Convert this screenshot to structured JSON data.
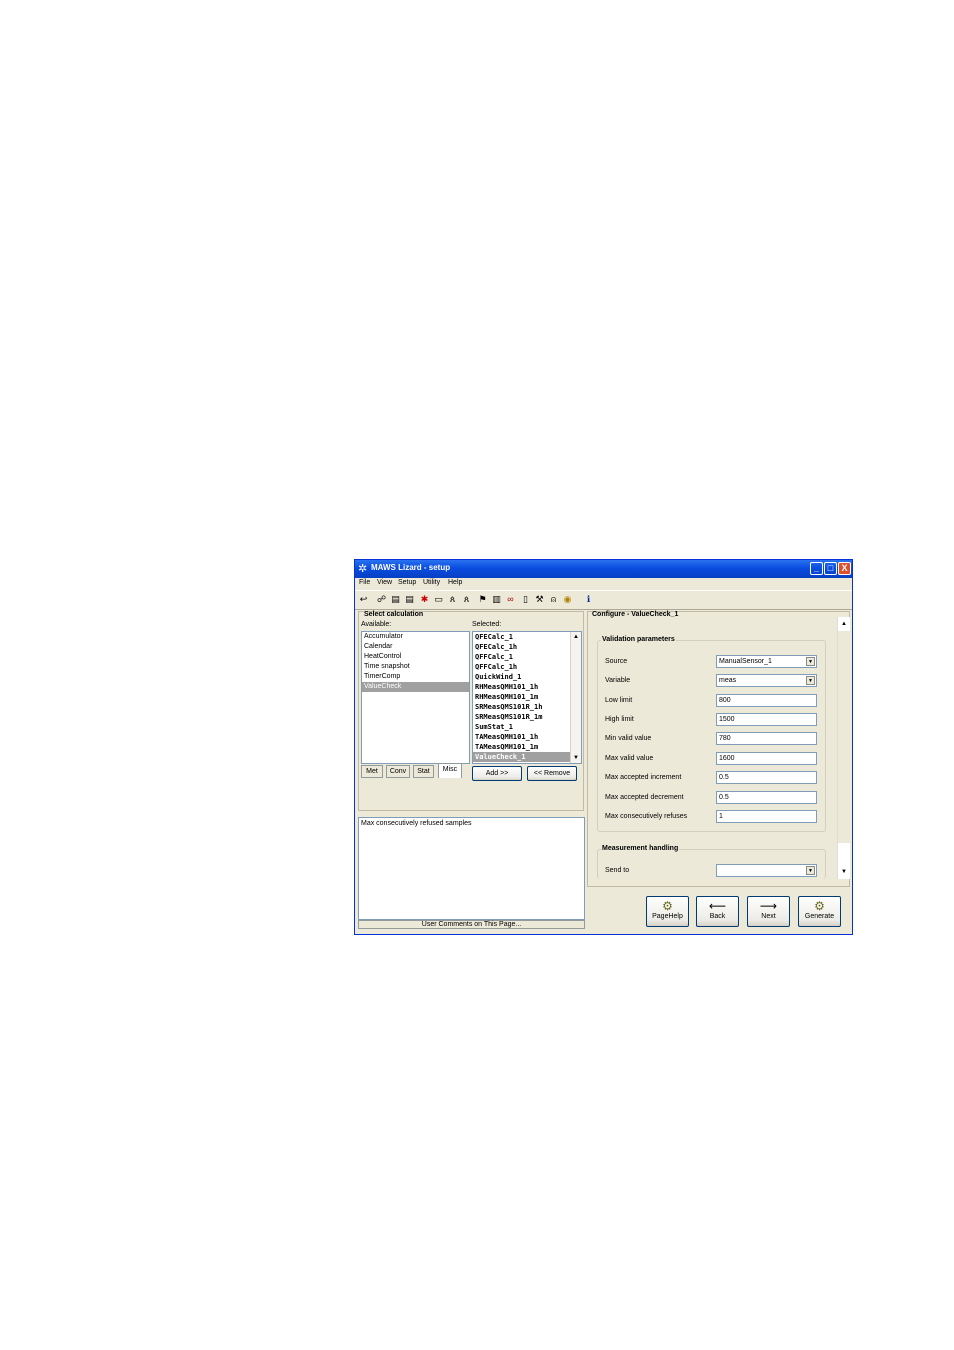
{
  "window": {
    "title": "MAWS Lizard - setup",
    "title_icon": "lizard-icon",
    "controls": [
      "_",
      "□",
      "X"
    ]
  },
  "menu": [
    "File",
    "View",
    "Setup",
    "Utility",
    "Help"
  ],
  "toolbar": {
    "icons": [
      "undo-icon",
      "network-icon",
      "dev-icon",
      "dev-icon",
      "sensor-icon",
      "display-icon",
      "person-icon",
      "person-icon",
      "flag-icon",
      "chart-icon",
      "link-icon",
      "page-icon",
      "wrench-icon",
      "bell-icon",
      "coin-icon",
      "info-icon"
    ],
    "glyphs": [
      "↩",
      "☍",
      "▤",
      "▤",
      "✱",
      "▭",
      "ጰ",
      "ጰ",
      "⚑",
      "▥",
      "∞",
      "▯",
      "⚒",
      "⍝",
      "◉",
      "ℹ"
    ]
  },
  "left": {
    "section_title": "Select calculation",
    "available_label": "Available:",
    "selected_label": "Selected:",
    "available": [
      "Accumulator",
      "Calendar",
      "HeatControl",
      "Time snapshot",
      "TimerComp",
      "ValueCheck"
    ],
    "available_selected_index": 5,
    "selected": [
      "QFECalc_1",
      "QFECalc_1h",
      "QFFCalc_1",
      "QFFCalc_1h",
      "QuickWind_1",
      "RHMeasQMH101_1h",
      "RHMeasQMH101_1m",
      "SRMeasQMS101R_1h",
      "SRMeasQMS101R_1m",
      "SumStat_1",
      "TAMeasQMH101_1h",
      "TAMeasQMH101_1m",
      "ValueCheck_1"
    ],
    "selected_selected_index": 12,
    "tabs": [
      "Met",
      "Conv",
      "Stat",
      "Misc"
    ],
    "active_tab": "Misc",
    "add_label": "Add >>",
    "remove_label": "<< Remove",
    "comment_text": "Max consecutively refused samples",
    "comments_bar": "User Comments on This Page..."
  },
  "right": {
    "header": "Configure - ValueCheck_1",
    "validation_group": "Validation parameters",
    "fields": [
      {
        "label": "Source",
        "value": "ManualSensor_1",
        "combo": true
      },
      {
        "label": "Variable",
        "value": "meas",
        "combo": true
      },
      {
        "label": "Low limit",
        "value": "800",
        "combo": false
      },
      {
        "label": "High limit",
        "value": "1500",
        "combo": false
      },
      {
        "label": "Min valid value",
        "value": "780",
        "combo": false
      },
      {
        "label": "Max valid value",
        "value": "1600",
        "combo": false
      },
      {
        "label": "Max accepted increment",
        "value": "0.5",
        "combo": false
      },
      {
        "label": "Max accepted decrement",
        "value": "0.5",
        "combo": false
      },
      {
        "label": "Max consecutively refuses",
        "value": "1",
        "combo": false
      }
    ],
    "measurement_group": "Measurement handling",
    "send_to_label": "Send to",
    "send_to_value": ""
  },
  "buttons": {
    "pagehelp": "PageHelp",
    "back": "Back",
    "next": "Next",
    "generate": "Generate"
  }
}
